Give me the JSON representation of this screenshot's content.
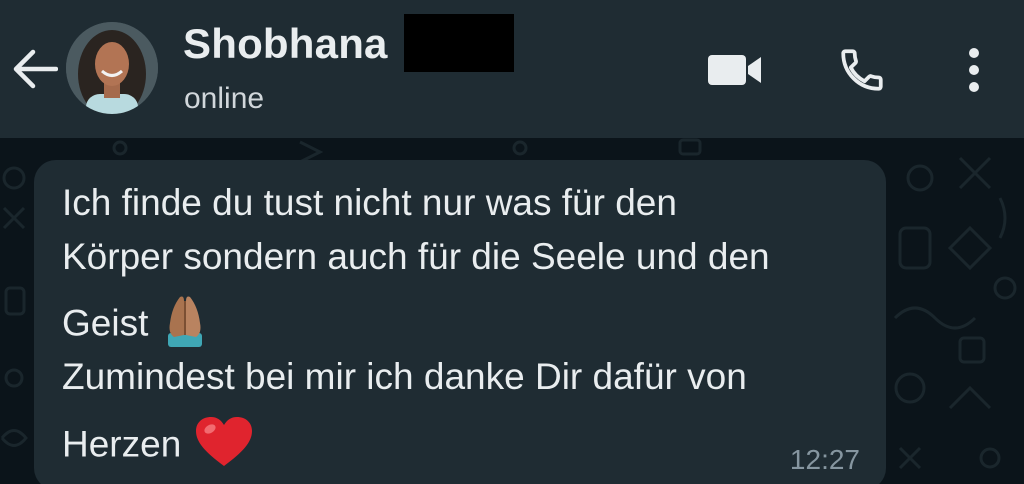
{
  "header": {
    "contact_name": "Shobhana",
    "status": "online",
    "icons": {
      "back": "arrow-left-icon",
      "video": "video-camera-icon",
      "call": "phone-icon",
      "menu": "more-vertical-icon"
    }
  },
  "message": {
    "lines": [
      "Ich finde du tust nicht nur was für den",
      "Körper sondern auch für die Seele und den",
      "Geist",
      "Zumindest bei mir ich danke Dir dafür von",
      "Herzen"
    ],
    "emojis": [
      "folded-hands-emoji",
      "red-heart-emoji"
    ],
    "time": "12:27"
  },
  "colors": {
    "header_bg": "#1f2c33",
    "chat_bg": "#0b141a",
    "bubble_bg": "#1f2c33",
    "text": "#e9edef",
    "muted": "#8696a0"
  }
}
